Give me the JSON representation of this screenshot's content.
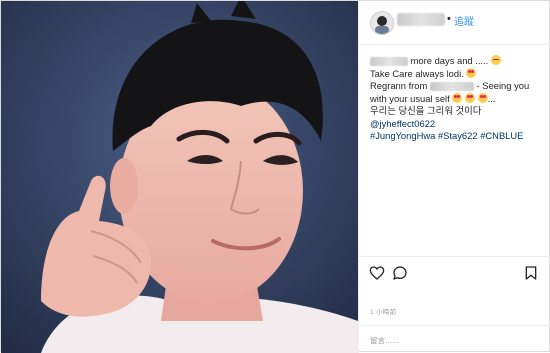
{
  "header": {
    "follow_label": "追蹤",
    "separator": "•"
  },
  "caption": {
    "line1_text": "more days and .....",
    "line2_text": "Take Care always lodi.",
    "line3_prefix": "Regrann from",
    "line3_suffix": "- Seeing you with your usual self",
    "line3_ellipsis": "...",
    "line4_text": "우리는 당신을 그리워 것이다",
    "mention": "@jyheffect0622",
    "hashtags": [
      "#JungYongHwa",
      "#Stay622",
      "#CNBLUE"
    ]
  },
  "meta": {
    "time_label": "1 小時前"
  },
  "comment": {
    "placeholder": "留言……"
  },
  "icons": {
    "like": "heart-outline-icon",
    "comment": "speech-bubble-icon",
    "save": "bookmark-icon",
    "verified": "none"
  },
  "colors": {
    "link": "#3897f0",
    "hashtag": "#003569",
    "meta": "#999999",
    "border": "#dbdbdb"
  }
}
